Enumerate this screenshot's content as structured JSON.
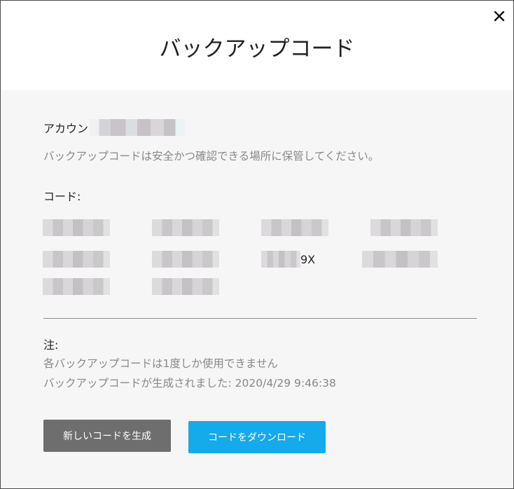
{
  "dialog": {
    "title": "バックアップコード",
    "close_icon": "close-icon"
  },
  "account": {
    "label": "アカウン"
  },
  "notice": "バックアップコードは安全かつ確認できる場所に保管してください。",
  "codes": {
    "label": "コード:",
    "partial_visible_text": "9X"
  },
  "notes": {
    "heading": "注:",
    "line1": "各バックアップコードは1度しか使用できません",
    "line2": "バックアップコードが生成されました: 2020/4/29 9:46:38"
  },
  "buttons": {
    "regenerate_label": "新しいコードを生成",
    "download_label": "コードをダウンロード",
    "regenerate_color": "#6e6e6e",
    "download_color": "#14aaeb"
  }
}
